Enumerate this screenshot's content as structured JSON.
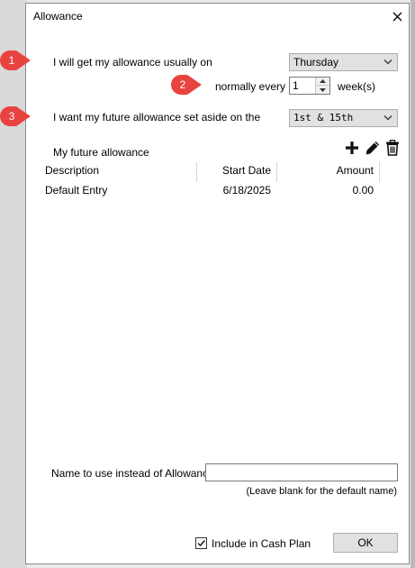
{
  "window": {
    "title": "Allowance"
  },
  "callouts": [
    "1",
    "2",
    "3"
  ],
  "row1": {
    "label": "I will get my allowance usually on",
    "day_value": "Thursday"
  },
  "row2": {
    "label": "normally every",
    "interval_value": "1",
    "unit": "week(s)"
  },
  "row3": {
    "label": "I want my future allowance set aside on the",
    "schedule_value": "1st & 15th"
  },
  "future": {
    "title": "My future allowance",
    "icons": [
      "add-icon",
      "edit-icon",
      "delete-icon"
    ],
    "columns": [
      "Description",
      "Start Date",
      "Amount"
    ],
    "rows": [
      {
        "description": "Default Entry",
        "start_date": "6/18/2025",
        "amount": "0.00"
      }
    ]
  },
  "name_field": {
    "label": "Name to use instead of Allowance",
    "value": "",
    "hint": "(Leave blank for the default name)"
  },
  "footer": {
    "checkbox_label": "Include in Cash Plan",
    "checked": true,
    "ok_label": "OK"
  },
  "colors": {
    "callout": "#e8433f",
    "window_bg": "#ffffff",
    "border": "#8c8c8c"
  }
}
